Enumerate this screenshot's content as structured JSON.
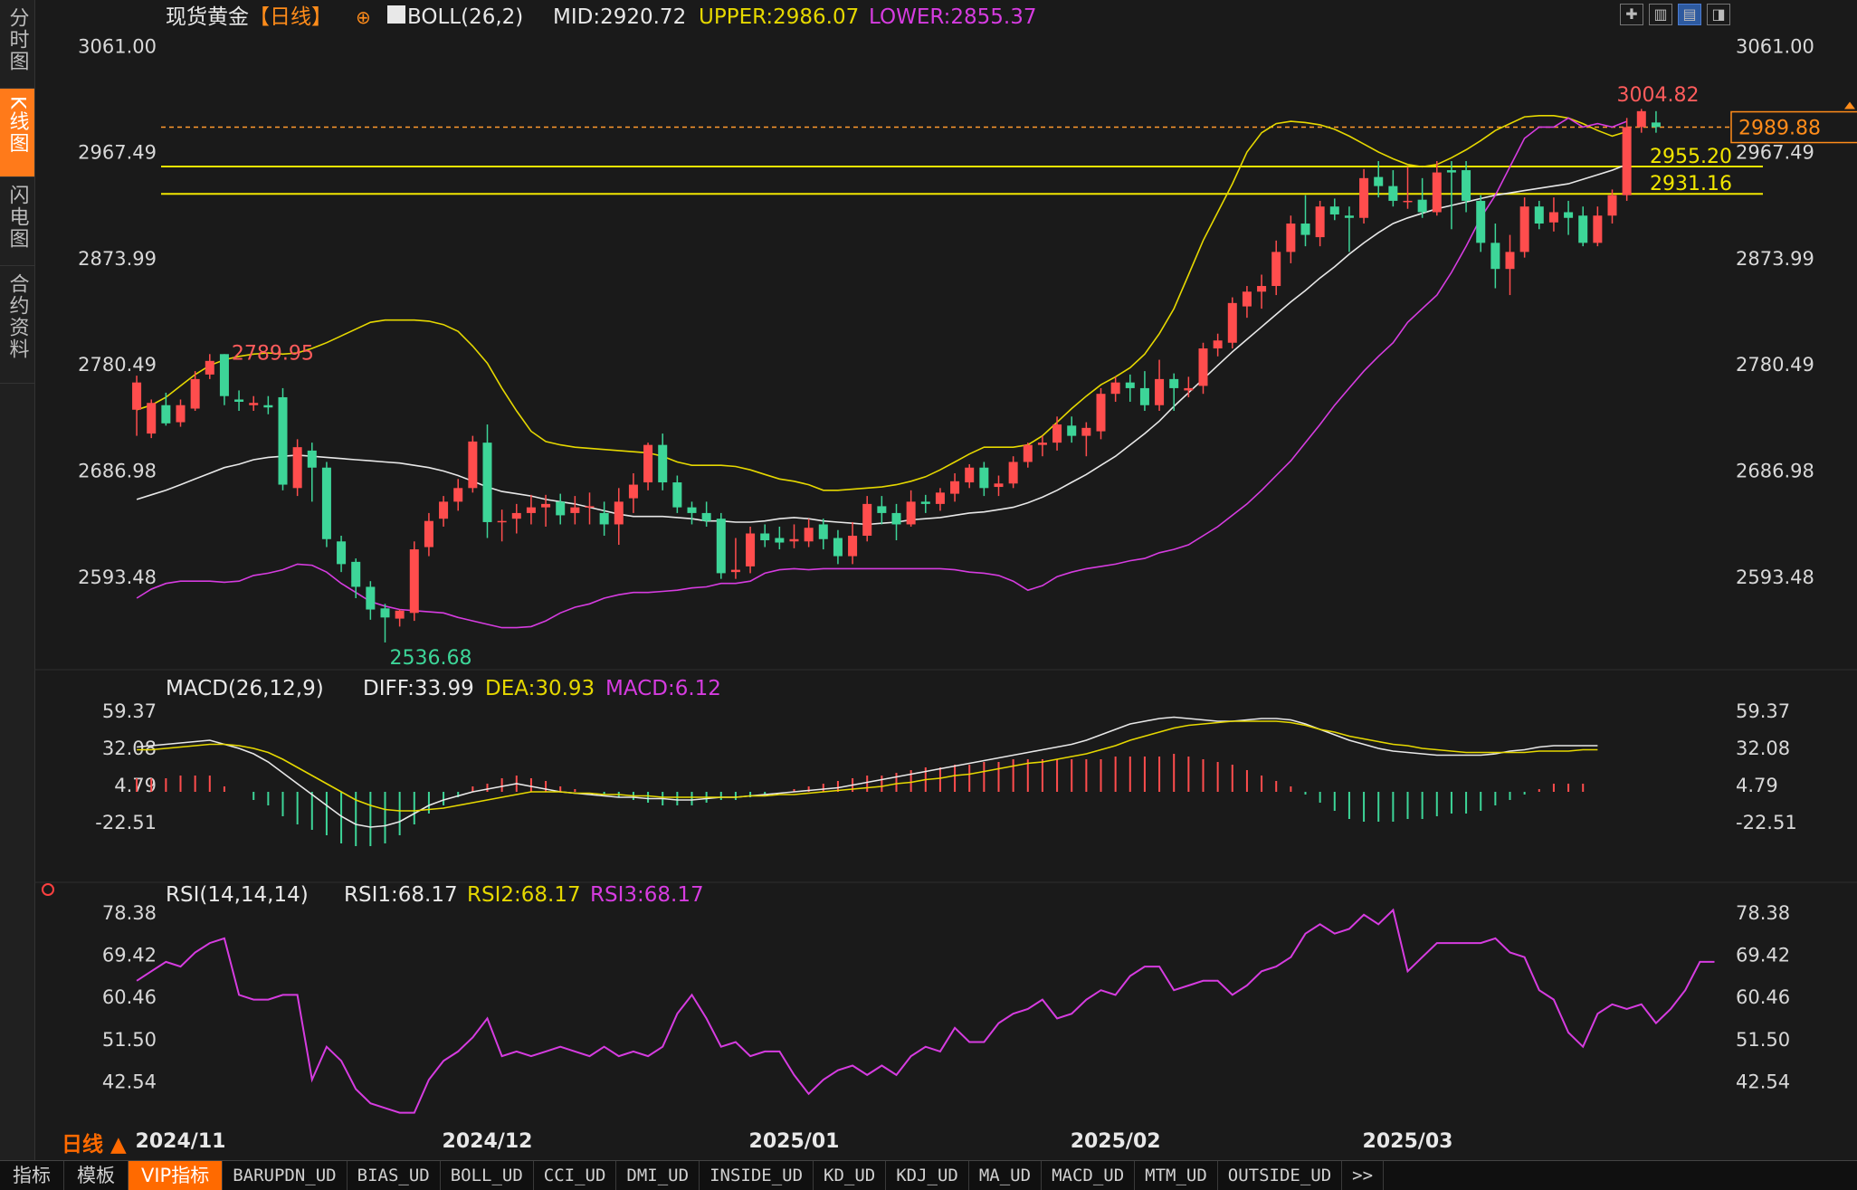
{
  "sidebar": {
    "tabs": [
      {
        "label": "分时图",
        "active": false
      },
      {
        "label": "K线图",
        "active": true
      },
      {
        "label": "闪电图",
        "active": false
      },
      {
        "label": "合约资料",
        "active": false
      }
    ]
  },
  "header": {
    "instrument": "现货黄金",
    "period": "【日线】",
    "indicator_name": "BOLL(26,2)",
    "mid": "MID:2920.72",
    "upper": "UPPER:2986.07",
    "lower": "LOWER:2855.37"
  },
  "macd_header": {
    "name": "MACD(26,12,9)",
    "diff": "DIFF:33.99",
    "dea": "DEA:30.93",
    "macd": "MACD:6.12"
  },
  "rsi_header": {
    "name": "RSI(14,14,14)",
    "rsi1": "RSI1:68.17",
    "rsi2": "RSI2:68.17",
    "rsi3": "RSI3:68.17"
  },
  "bottom_tabs": [
    "指标",
    "模板",
    "VIP指标",
    "BARUPDN_UD",
    "BIAS_UD",
    "BOLL_UD",
    "CCI_UD",
    "DMI_UD",
    "INSIDE_UD",
    "KD_UD",
    "KDJ_UD",
    "MA_UD",
    "MACD_UD",
    "MTM_UD",
    "OUTSIDE_UD",
    ">>"
  ],
  "period_label": "日线 ▲",
  "colors": {
    "up": "#ff4d4d",
    "down": "#3dd598",
    "mid": "#e8e8e8",
    "upper": "#e6d800",
    "lower": "#d63ce0",
    "hline": "#f2e600",
    "dashed": "#ff9a2e",
    "price_box": "#ff8c1a"
  },
  "chart_data": {
    "type": "candlestick",
    "price_axis_ticks": [
      "3061.00",
      "2967.49",
      "2873.99",
      "2780.49",
      "2686.98",
      "2593.48"
    ],
    "price_axis_values": [
      3061.0,
      2967.49,
      2873.99,
      2780.49,
      2686.98,
      2593.48
    ],
    "ylim": [
      2520,
      3078
    ],
    "x_axis_labels": [
      {
        "label": "2024/11",
        "index": 3
      },
      {
        "label": "2024/12",
        "index": 24
      },
      {
        "label": "2025/01",
        "index": 45
      },
      {
        "label": "2025/02",
        "index": 67
      },
      {
        "label": "2025/03",
        "index": 87
      }
    ],
    "annotations": {
      "high": {
        "text": "3004.82",
        "value": 3004.82,
        "index": 101
      },
      "low": {
        "text": "2536.68",
        "value": 2536.68,
        "index": 17
      },
      "left_high": {
        "text": "2789.95",
        "value": 2789.95,
        "index": 6
      },
      "line1": {
        "text": "2955.20",
        "value": 2955.2
      },
      "line2": {
        "text": "2931.16",
        "value": 2931.16
      },
      "last": {
        "text": "2989.88",
        "value": 2989.88
      }
    },
    "candles": [
      [
        2741,
        2765,
        2718,
        2771
      ],
      [
        2720,
        2747,
        2716,
        2750
      ],
      [
        2745,
        2729,
        2727,
        2756
      ],
      [
        2730,
        2745,
        2726,
        2750
      ],
      [
        2742,
        2768,
        2740,
        2775
      ],
      [
        2772,
        2784,
        2768,
        2790
      ],
      [
        2790,
        2753,
        2745,
        2790
      ],
      [
        2750,
        2748,
        2740,
        2758
      ],
      [
        2745,
        2747,
        2740,
        2753
      ],
      [
        2745,
        2743,
        2737,
        2753
      ],
      [
        2752,
        2675,
        2670,
        2760
      ],
      [
        2672,
        2708,
        2665,
        2715
      ],
      [
        2705,
        2690,
        2660,
        2712
      ],
      [
        2690,
        2627,
        2620,
        2695
      ],
      [
        2625,
        2605,
        2598,
        2630
      ],
      [
        2607,
        2585,
        2575,
        2610
      ],
      [
        2585,
        2565,
        2556,
        2590
      ],
      [
        2566,
        2558,
        2536,
        2570
      ],
      [
        2557,
        2564,
        2550,
        2565
      ],
      [
        2562,
        2618,
        2555,
        2625
      ],
      [
        2620,
        2643,
        2612,
        2650
      ],
      [
        2645,
        2660,
        2638,
        2665
      ],
      [
        2660,
        2672,
        2652,
        2680
      ],
      [
        2672,
        2713,
        2668,
        2718
      ],
      [
        2712,
        2642,
        2628,
        2728
      ],
      [
        2642,
        2643,
        2625,
        2653
      ],
      [
        2645,
        2650,
        2632,
        2658
      ],
      [
        2650,
        2655,
        2640,
        2666
      ],
      [
        2655,
        2658,
        2638,
        2666
      ],
      [
        2660,
        2648,
        2640,
        2667
      ],
      [
        2650,
        2655,
        2640,
        2665
      ],
      [
        2655,
        2656,
        2640,
        2668
      ],
      [
        2650,
        2640,
        2630,
        2660
      ],
      [
        2640,
        2660,
        2622,
        2672
      ],
      [
        2663,
        2675,
        2650,
        2685
      ],
      [
        2677,
        2710,
        2670,
        2712
      ],
      [
        2710,
        2677,
        2670,
        2720
      ],
      [
        2677,
        2655,
        2650,
        2683
      ],
      [
        2655,
        2650,
        2640,
        2660
      ],
      [
        2650,
        2643,
        2638,
        2660
      ],
      [
        2645,
        2597,
        2592,
        2650
      ],
      [
        2598,
        2600,
        2592,
        2628
      ],
      [
        2603,
        2632,
        2597,
        2638
      ],
      [
        2632,
        2626,
        2620,
        2640
      ],
      [
        2628,
        2624,
        2618,
        2638
      ],
      [
        2625,
        2627,
        2619,
        2640
      ],
      [
        2625,
        2637,
        2620,
        2645
      ],
      [
        2640,
        2627,
        2618,
        2645
      ],
      [
        2628,
        2612,
        2605,
        2635
      ],
      [
        2612,
        2630,
        2605,
        2642
      ],
      [
        2630,
        2658,
        2625,
        2665
      ],
      [
        2656,
        2650,
        2640,
        2665
      ],
      [
        2650,
        2640,
        2626,
        2658
      ],
      [
        2640,
        2660,
        2638,
        2670
      ],
      [
        2660,
        2658,
        2650,
        2666
      ],
      [
        2658,
        2668,
        2652,
        2672
      ],
      [
        2667,
        2678,
        2660,
        2685
      ],
      [
        2677,
        2690,
        2672,
        2693
      ],
      [
        2690,
        2672,
        2665,
        2695
      ],
      [
        2673,
        2676,
        2665,
        2683
      ],
      [
        2676,
        2695,
        2672,
        2700
      ],
      [
        2695,
        2710,
        2690,
        2712
      ],
      [
        2710,
        2712,
        2700,
        2718
      ],
      [
        2712,
        2728,
        2705,
        2735
      ],
      [
        2727,
        2718,
        2712,
        2735
      ],
      [
        2718,
        2725,
        2700,
        2730
      ],
      [
        2722,
        2755,
        2715,
        2760
      ],
      [
        2755,
        2765,
        2748,
        2770
      ],
      [
        2765,
        2760,
        2748,
        2772
      ],
      [
        2760,
        2745,
        2740,
        2775
      ],
      [
        2745,
        2768,
        2740,
        2785
      ],
      [
        2768,
        2760,
        2740,
        2773
      ],
      [
        2758,
        2760,
        2752,
        2770
      ],
      [
        2762,
        2795,
        2755,
        2800
      ],
      [
        2795,
        2802,
        2788,
        2808
      ],
      [
        2800,
        2835,
        2795,
        2840
      ],
      [
        2832,
        2845,
        2822,
        2850
      ],
      [
        2845,
        2850,
        2830,
        2860
      ],
      [
        2850,
        2880,
        2842,
        2890
      ],
      [
        2880,
        2905,
        2870,
        2912
      ],
      [
        2905,
        2895,
        2885,
        2930
      ],
      [
        2893,
        2920,
        2885,
        2925
      ],
      [
        2920,
        2913,
        2908,
        2927
      ],
      [
        2912,
        2910,
        2880,
        2920
      ],
      [
        2910,
        2945,
        2905,
        2953
      ],
      [
        2946,
        2938,
        2928,
        2960
      ],
      [
        2938,
        2925,
        2920,
        2952
      ],
      [
        2925,
        2925,
        2918,
        2955
      ],
      [
        2926,
        2915,
        2910,
        2945
      ],
      [
        2915,
        2950,
        2912,
        2960
      ],
      [
        2952,
        2950,
        2900,
        2960
      ],
      [
        2952,
        2925,
        2915,
        2960
      ],
      [
        2925,
        2888,
        2880,
        2930
      ],
      [
        2888,
        2865,
        2848,
        2905
      ],
      [
        2865,
        2880,
        2842,
        2895
      ],
      [
        2880,
        2920,
        2875,
        2928
      ],
      [
        2920,
        2905,
        2900,
        2925
      ],
      [
        2906,
        2915,
        2898,
        2928
      ],
      [
        2915,
        2910,
        2895,
        2925
      ],
      [
        2912,
        2888,
        2885,
        2920
      ],
      [
        2888,
        2912,
        2885,
        2920
      ],
      [
        2912,
        2930,
        2905,
        2935
      ],
      [
        2930,
        2990,
        2925,
        2998
      ],
      [
        2990,
        3004,
        2985,
        3006
      ],
      [
        2994,
        2990,
        2985,
        3004
      ]
    ],
    "boll_mid": [
      2662,
      2666,
      2670,
      2675,
      2680,
      2685,
      2690,
      2693,
      2697,
      2699,
      2700,
      2701,
      2700,
      2699,
      2698,
      2697,
      2696,
      2695,
      2694,
      2692,
      2690,
      2687,
      2683,
      2678,
      2673,
      2669,
      2667,
      2665,
      2662,
      2660,
      2658,
      2655,
      2652,
      2649,
      2647,
      2647,
      2647,
      2646,
      2645,
      2643,
      2643,
      2642,
      2642,
      2643,
      2645,
      2646,
      2645,
      2643,
      2642,
      2641,
      2640,
      2641,
      2642,
      2644,
      2645,
      2646,
      2648,
      2650,
      2651,
      2653,
      2655,
      2659,
      2664,
      2670,
      2677,
      2684,
      2692,
      2700,
      2710,
      2720,
      2731,
      2744,
      2756,
      2768,
      2780,
      2792,
      2803,
      2814,
      2825,
      2836,
      2846,
      2857,
      2867,
      2878,
      2888,
      2897,
      2905,
      2910,
      2914,
      2918,
      2921,
      2924,
      2927,
      2930,
      2932,
      2934,
      2936,
      2938,
      2940,
      2944,
      2948,
      2952,
      2957
    ],
    "boll_upper": [
      2741,
      2745,
      2752,
      2762,
      2772,
      2780,
      2785,
      2788,
      2790,
      2791,
      2790,
      2791,
      2795,
      2800,
      2806,
      2812,
      2818,
      2820,
      2820,
      2820,
      2819,
      2816,
      2810,
      2797,
      2782,
      2760,
      2740,
      2722,
      2713,
      2710,
      2708,
      2707,
      2706,
      2705,
      2704,
      2703,
      2700,
      2695,
      2692,
      2692,
      2692,
      2691,
      2688,
      2684,
      2680,
      2678,
      2675,
      2670,
      2670,
      2671,
      2672,
      2673,
      2675,
      2678,
      2682,
      2688,
      2695,
      2702,
      2708,
      2708,
      2708,
      2710,
      2718,
      2730,
      2742,
      2753,
      2763,
      2770,
      2778,
      2790,
      2808,
      2830,
      2860,
      2890,
      2915,
      2940,
      2968,
      2985,
      2993,
      2995,
      2994,
      2992,
      2988,
      2982,
      2975,
      2968,
      2962,
      2957,
      2955,
      2957,
      2963,
      2970,
      2978,
      2987,
      2993,
      2999,
      3000,
      3000,
      2998,
      2993,
      2987,
      2982,
      2986
    ],
    "boll_lower": [
      2575,
      2583,
      2588,
      2590,
      2590,
      2590,
      2589,
      2590,
      2595,
      2597,
      2600,
      2605,
      2604,
      2598,
      2588,
      2580,
      2572,
      2568,
      2565,
      2564,
      2563,
      2562,
      2558,
      2555,
      2552,
      2549,
      2549,
      2550,
      2555,
      2562,
      2567,
      2570,
      2575,
      2578,
      2580,
      2580,
      2581,
      2582,
      2584,
      2585,
      2588,
      2588,
      2590,
      2597,
      2600,
      2601,
      2600,
      2601,
      2601,
      2601,
      2601,
      2601,
      2601,
      2601,
      2601,
      2601,
      2600,
      2598,
      2597,
      2595,
      2590,
      2582,
      2586,
      2594,
      2598,
      2601,
      2603,
      2605,
      2608,
      2610,
      2615,
      2618,
      2622,
      2630,
      2638,
      2648,
      2658,
      2670,
      2683,
      2696,
      2712,
      2728,
      2745,
      2760,
      2775,
      2788,
      2800,
      2818,
      2830,
      2842,
      2862,
      2885,
      2910,
      2930,
      2955,
      2980,
      2990,
      2990,
      2998,
      2990,
      2993,
      2990,
      2995
    ],
    "macd_ticks": [
      "59.37",
      "32.08",
      "4.79",
      "-22.51"
    ],
    "macd_tick_values": [
      59.37,
      32.08,
      4.79,
      -22.51
    ],
    "macd_ylim": [
      -50,
      70
    ],
    "macd_hist": [
      10,
      10,
      10,
      12,
      12,
      12,
      4,
      0,
      -6,
      -10,
      -18,
      -24,
      -28,
      -32,
      -38,
      -40,
      -40,
      -38,
      -32,
      -24,
      -16,
      -10,
      -4,
      4,
      6,
      10,
      12,
      10,
      8,
      4,
      2,
      0,
      -2,
      -4,
      -6,
      -8,
      -10,
      -10,
      -10,
      -8,
      -6,
      -6,
      -4,
      -2,
      0,
      2,
      4,
      6,
      8,
      10,
      12,
      12,
      14,
      16,
      18,
      18,
      20,
      20,
      22,
      22,
      24,
      24,
      24,
      24,
      24,
      24,
      24,
      26,
      26,
      26,
      26,
      28,
      26,
      24,
      22,
      20,
      16,
      12,
      8,
      4,
      -2,
      -8,
      -14,
      -20,
      -22,
      -22,
      -22,
      -20,
      -20,
      -18,
      -16,
      -16,
      -14,
      -10,
      -6,
      -2,
      2,
      6,
      6,
      6
    ],
    "macd_diff": [
      33,
      34,
      35,
      36,
      37,
      38,
      35,
      32,
      28,
      22,
      14,
      6,
      -2,
      -10,
      -18,
      -24,
      -26,
      -25,
      -22,
      -16,
      -10,
      -6,
      -3,
      0,
      2,
      4,
      6,
      4,
      2,
      0,
      -1,
      -2,
      -3,
      -4,
      -4,
      -5,
      -5,
      -6,
      -6,
      -5,
      -4,
      -4,
      -3,
      -2,
      -1,
      0,
      1,
      2,
      3,
      5,
      7,
      9,
      11,
      13,
      15,
      17,
      19,
      21,
      23,
      25,
      27,
      29,
      31,
      33,
      35,
      38,
      42,
      46,
      50,
      52,
      54,
      55,
      54,
      53,
      52,
      52,
      53,
      54,
      54,
      53,
      50,
      46,
      42,
      38,
      35,
      32,
      30,
      29,
      28,
      27,
      27,
      27,
      27,
      28,
      30,
      31,
      33,
      34,
      34,
      34,
      34
    ],
    "macd_dea": [
      31,
      31,
      32,
      33,
      34,
      35,
      35,
      34,
      32,
      29,
      24,
      18,
      12,
      6,
      0,
      -6,
      -10,
      -13,
      -14,
      -14,
      -13,
      -12,
      -10,
      -8,
      -6,
      -4,
      -2,
      0,
      0,
      0,
      -1,
      -1,
      -2,
      -2,
      -3,
      -3,
      -4,
      -4,
      -4,
      -4,
      -4,
      -4,
      -3,
      -3,
      -2,
      -2,
      -1,
      0,
      1,
      2,
      3,
      4,
      6,
      7,
      9,
      10,
      12,
      13,
      15,
      17,
      19,
      21,
      22,
      24,
      26,
      28,
      31,
      34,
      38,
      41,
      44,
      47,
      49,
      50,
      51,
      52,
      52,
      52,
      52,
      51,
      49,
      46,
      44,
      41,
      39,
      37,
      35,
      34,
      32,
      31,
      30,
      29,
      29,
      29,
      29,
      29,
      30,
      30,
      30,
      31,
      31
    ],
    "rsi_ticks": [
      "78.38",
      "69.42",
      "60.46",
      "51.50",
      "42.54"
    ],
    "rsi_tick_values": [
      78.38,
      69.42,
      60.46,
      51.5,
      42.54
    ],
    "rsi_ylim": [
      34,
      82
    ],
    "rsi": [
      64,
      66,
      68,
      67,
      70,
      72,
      73,
      61,
      60,
      60,
      61,
      61,
      43,
      50,
      47,
      41,
      38,
      37,
      36,
      36,
      43,
      47,
      49,
      52,
      56,
      48,
      49,
      48,
      49,
      50,
      49,
      48,
      50,
      48,
      49,
      48,
      50,
      57,
      61,
      56,
      50,
      51,
      48,
      49,
      49,
      44,
      40,
      43,
      45,
      46,
      44,
      46,
      44,
      48,
      50,
      49,
      54,
      51,
      51,
      55,
      57,
      58,
      60,
      56,
      57,
      60,
      62,
      61,
      65,
      67,
      67,
      62,
      63,
      64,
      64,
      61,
      63,
      66,
      67,
      69,
      74,
      76,
      74,
      75,
      78,
      76,
      79,
      66,
      69,
      72,
      72,
      72,
      72,
      73,
      70,
      69,
      62,
      60,
      53,
      50,
      57,
      59,
      58,
      59,
      55,
      58,
      62,
      68,
      68
    ]
  }
}
